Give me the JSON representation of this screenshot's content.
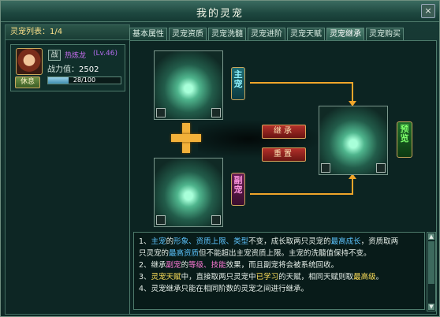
{
  "window": {
    "title": "我的灵宠",
    "close_label": "×"
  },
  "pet_list": {
    "header": "灵宠列表：1/4",
    "pet": {
      "battle_tag": "战",
      "name": "热炼龙",
      "level": "(Lv.46)",
      "power_label": "战力值：",
      "power_value": "2502",
      "exp_text": "28/100",
      "exp_fraction": 0.28,
      "rest_button": "休息"
    }
  },
  "tabs": [
    {
      "label": "基本属性"
    },
    {
      "label": "灵宠资质"
    },
    {
      "label": "灵宠洗髓"
    },
    {
      "label": "灵宠进阶"
    },
    {
      "label": "灵宠天赋"
    },
    {
      "label": "灵宠继承"
    },
    {
      "label": "灵宠购买"
    }
  ],
  "active_tab": "灵宠继承",
  "inherit": {
    "main_badge": "主宠",
    "sub_badge": "副宠",
    "preview_badge": "预览",
    "inherit_button": "继承",
    "reset_button": "重置"
  },
  "tips": {
    "l1_a": "1、",
    "l1_b": "主宠",
    "l1_c": "的",
    "l1_d": "形象、资质上限、类型",
    "l1_e": "不变，成长取两只灵宠的",
    "l1_f": "最高成长",
    "l1_g": "，资质取两",
    "l1_h": "只灵宠的",
    "l1_i": "最高资质",
    "l1_j": "但不能超出主宠资质上限。主宠的洗髓值保持不变。",
    "l2_a": "2、继承",
    "l2_b": "副宠",
    "l2_c": "的",
    "l2_d": "等级、技能",
    "l2_e": "效果，而且副宠将会被系统回收。",
    "l3_a": "3、",
    "l3_b": "灵宠天赋",
    "l3_c": "中，直接取两只灵宠中",
    "l3_d": "已学习",
    "l3_e": "的天赋，相同天赋则取",
    "l3_f": "最高级",
    "l3_g": "。",
    "l4": "4、灵宠继承只能在相同阶数的灵宠之间进行继承。"
  },
  "colors": {
    "accent_gold": "#f0a52a",
    "highlight_blue": "#5cc4ff",
    "highlight_pink": "#ff7ad8",
    "highlight_yellow": "#ffe15a"
  }
}
